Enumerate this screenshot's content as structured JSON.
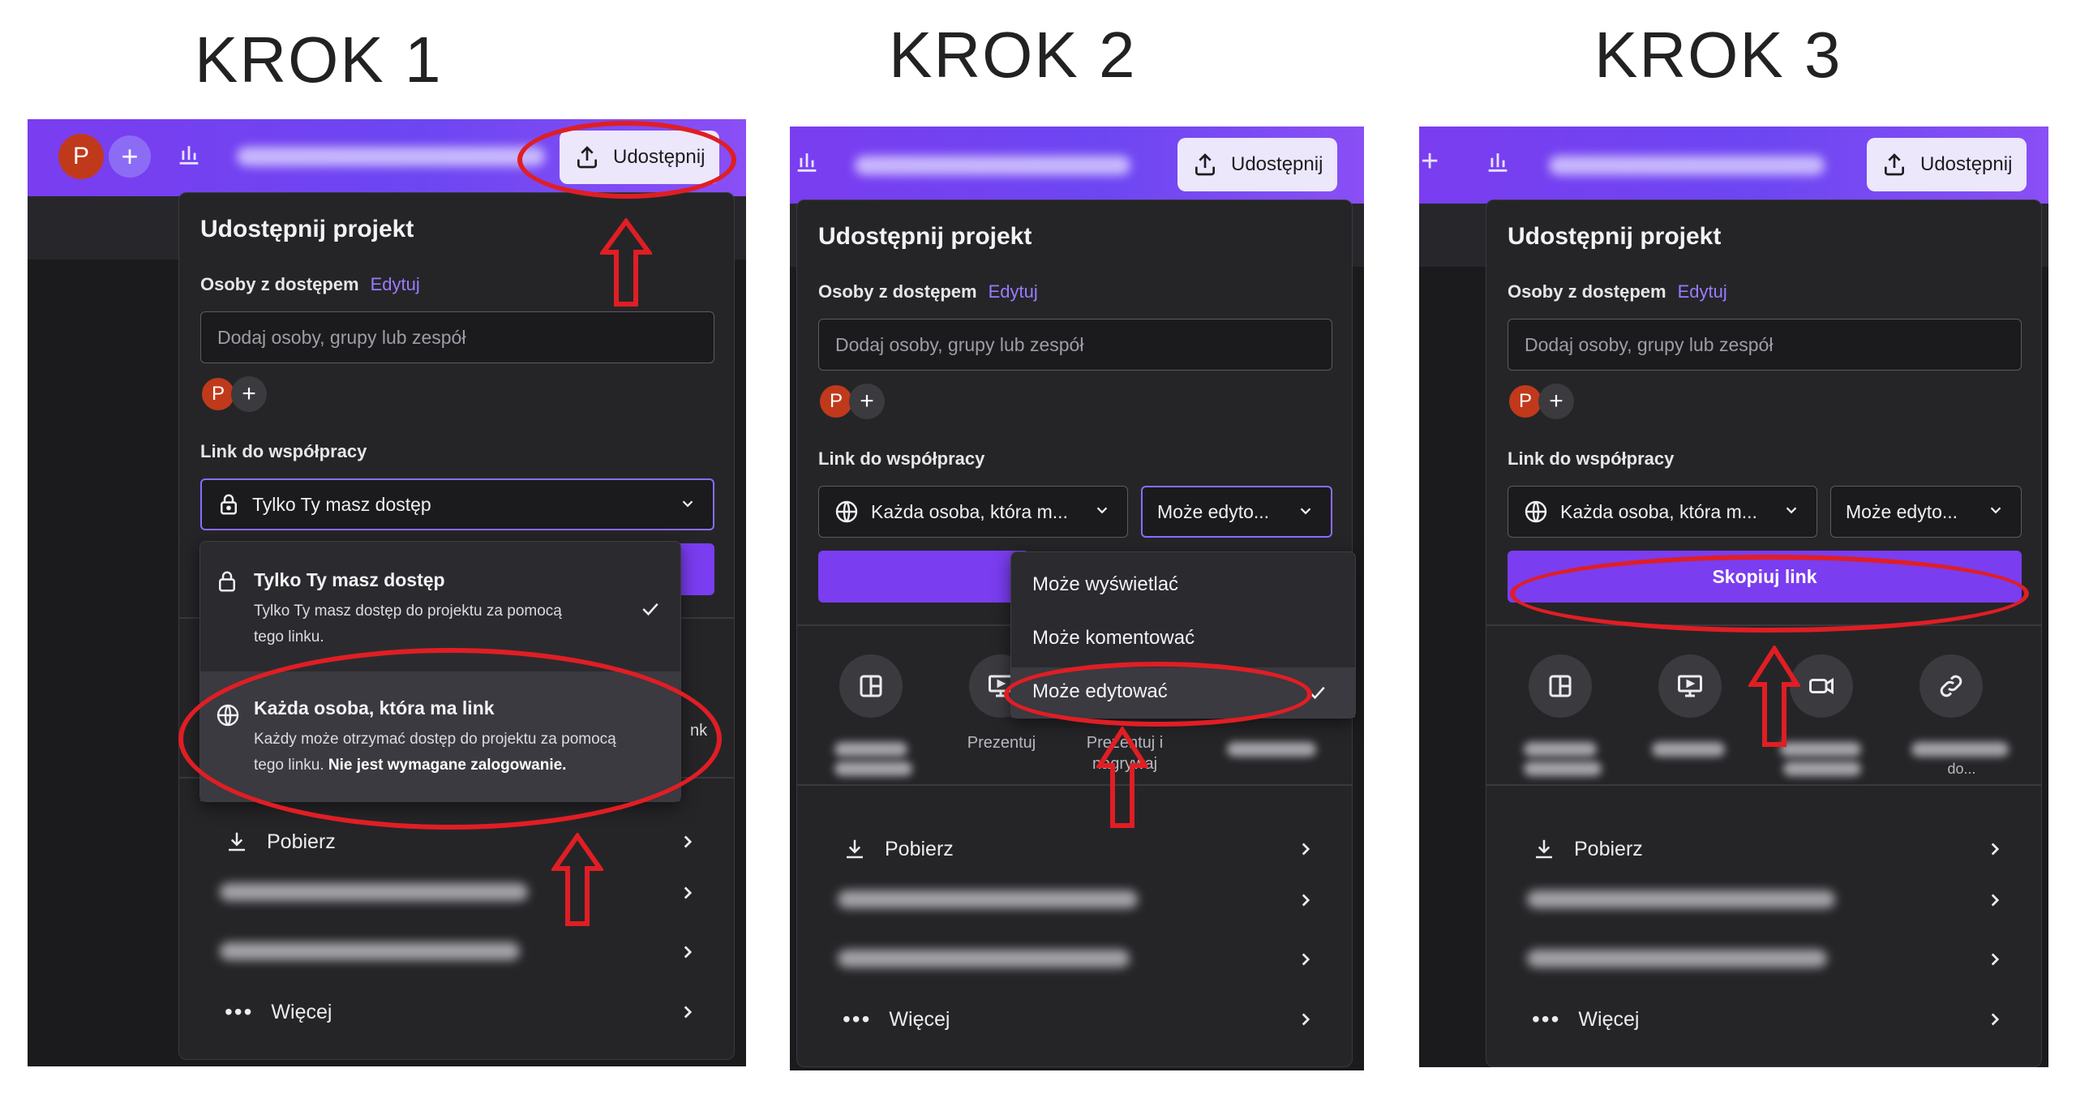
{
  "steps": [
    {
      "title": "KROK 1"
    },
    {
      "title": "KROK 2"
    },
    {
      "title": "KROK 3"
    }
  ],
  "topbar": {
    "avatar_initial": "P",
    "share_label": "Udostępnij"
  },
  "popup": {
    "title": "Udostępnij projekt",
    "people_label": "Osoby z dostępem",
    "edit_link": "Edytuj",
    "invite_placeholder": "Dodaj osoby, grupy lub zespół",
    "avatar_initial": "P",
    "link_label": "Link do współpracy",
    "copy_button": "Skopiuj link",
    "rows": {
      "download": "Pobierz",
      "more": "Więcej"
    }
  },
  "step1": {
    "access_select": "Tylko Ty masz dostęp",
    "dropdown": [
      {
        "title": "Tylko Ty masz dostęp",
        "desc1": "Tylko Ty masz dostęp do projektu za pomocą",
        "desc2": "tego linku.",
        "selected": true
      },
      {
        "title": "Każda osoba, która ma link",
        "desc1": "Każdy może otrzymać dostęp do projektu za pomocą",
        "desc2a": "tego linku.",
        "desc2b": "Nie jest wymagane zalogowanie.",
        "selected": false
      }
    ],
    "peek_text": "nk"
  },
  "step2": {
    "access_select": "Każda osoba, która m...",
    "perm_select": "Może edyto...",
    "perm_options": [
      "Może wyświetlać",
      "Może komentować",
      "Może edytować"
    ],
    "quick_labels": [
      "Prezentuj",
      "Prezentuj i",
      "nagrywaj"
    ]
  },
  "step3": {
    "access_select": "Każda osoba, która m...",
    "perm_select": "Może edyto...",
    "quick_labels_partial": [
      "do..."
    ]
  },
  "icons": [
    "share-icon",
    "chart-icon",
    "lock-icon",
    "globe-icon",
    "chevron-down-icon",
    "check-icon",
    "download-icon",
    "chevron-right-icon",
    "ellipsis-icon",
    "layout-icon",
    "present-icon",
    "record-icon",
    "link-icon"
  ],
  "colors": {
    "brand_purple": "#7a3df0",
    "annotation_red": "#e01e24",
    "panel_bg": "#252528"
  }
}
